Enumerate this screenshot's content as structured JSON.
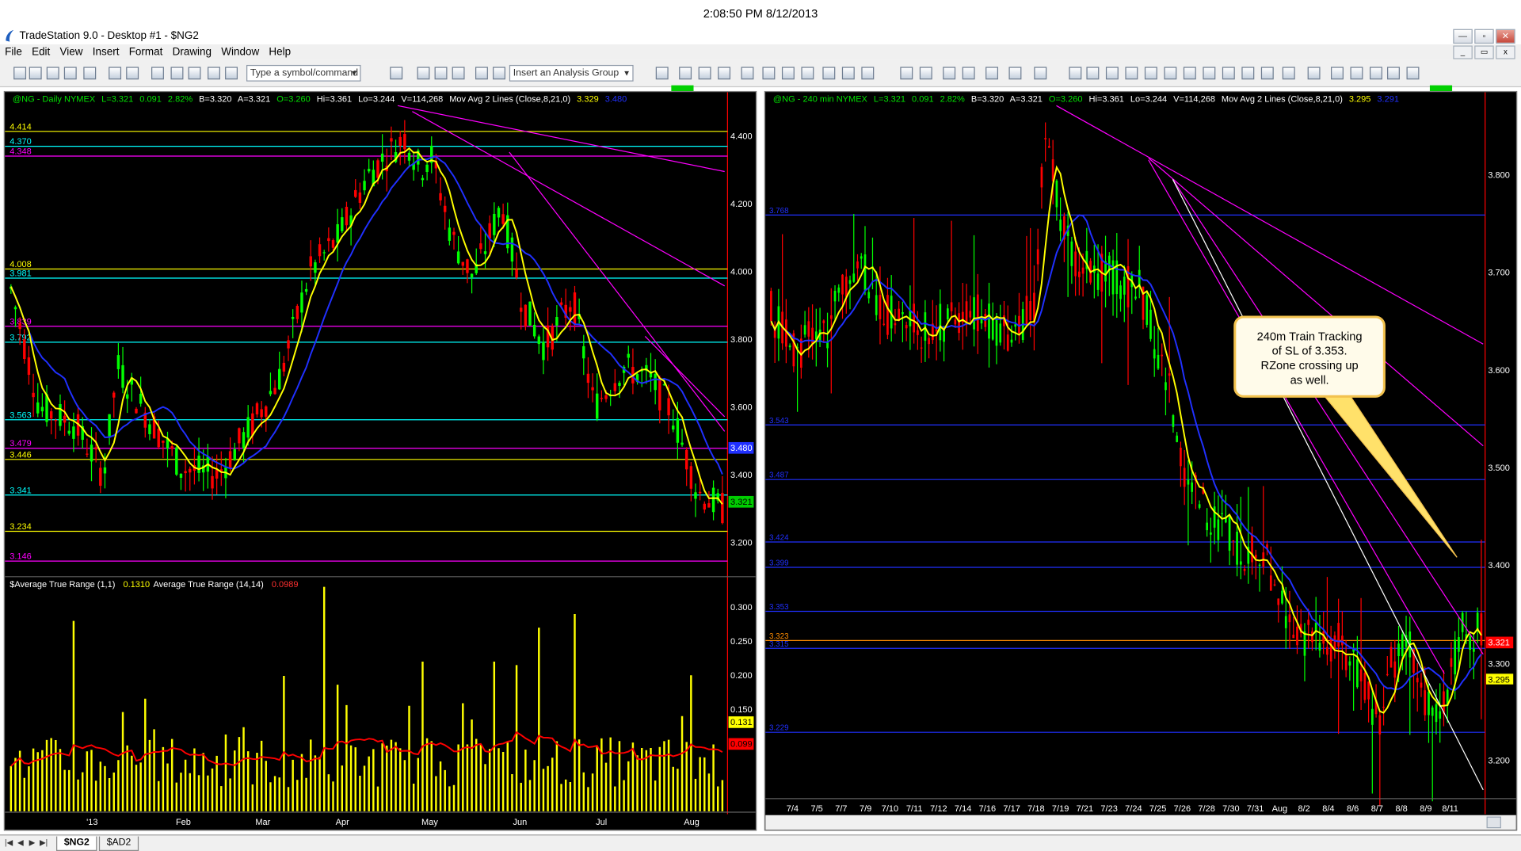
{
  "clock": "2:08:50 PM 8/12/2013",
  "window_title": "TradeStation 9.0 - Desktop #1 - $NG2",
  "menu": [
    "File",
    "Edit",
    "View",
    "Insert",
    "Format",
    "Drawing",
    "Window",
    "Help"
  ],
  "toolbar": {
    "symbol_placeholder": "Type a symbol/command",
    "analysis_group": "Insert an Analysis Group",
    "icons": [
      "new-icon",
      "open-icon",
      "save-icon",
      "print-preview-icon",
      "print-icon",
      "chart-icon",
      "quote-icon",
      "lock-icon",
      "zoom-in-icon",
      "zoom-out-icon",
      "cursor-icon",
      "trendline-icon",
      "fibonacci-icon",
      "arrow-up-icon",
      "arrow-down-icon",
      "circle-icon",
      "text-icon"
    ]
  },
  "colors": {
    "price": "#00ff00",
    "down": "#ff0000",
    "ma_fast": "#ffff00",
    "ma_slow": "#2030ff",
    "magenta": "#ff00ff",
    "cyan": "#00ffff"
  },
  "left_chart": {
    "header": {
      "symbol": "@NG - Daily  NYMEX",
      "last": "L=3.321",
      "chg": "0.091",
      "pct": "2.82%",
      "bid": "B=3.320",
      "ask": "A=3.321",
      "open": "O=3.260",
      "high": "Hi=3.361",
      "low": "Lo=3.244",
      "vol": "V=114,268",
      "study": "Mov Avg 2 Lines (Close,8,21,0)",
      "ma1": "3.329",
      "ma2": "3.480"
    },
    "y_ticks": [
      "4.400",
      "4.200",
      "4.000",
      "3.800",
      "3.600",
      "3.400",
      "3.200"
    ],
    "price_badge": "3.321",
    "ma_badge": "3.480",
    "levels": [
      {
        "label": "4.414",
        "color": "#ffff00",
        "value": 4.414
      },
      {
        "label": "4.370",
        "color": "#00ffff",
        "value": 4.37
      },
      {
        "label": "4.348",
        "color": "#ff00ff",
        "value": 4.341
      },
      {
        "label": "4.008",
        "color": "#ffff00",
        "value": 4.008
      },
      {
        "label": "3.981",
        "color": "#00ffff",
        "value": 3.981
      },
      {
        "label": "3.839",
        "color": "#ff00ff",
        "value": 3.839
      },
      {
        "label": "3.792",
        "color": "#00ffff",
        "value": 3.792
      },
      {
        "label": "3.563",
        "color": "#00ffff",
        "value": 3.563
      },
      {
        "label": "3.479",
        "color": "#ff00ff",
        "value": 3.479
      },
      {
        "label": "3.446",
        "color": "#ffff00",
        "value": 3.446
      },
      {
        "label": "3.341",
        "color": "#00ffff",
        "value": 3.341
      },
      {
        "label": "3.234",
        "color": "#ffff00",
        "value": 3.234
      },
      {
        "label": "3.146",
        "color": "#ff00ff",
        "value": 3.146
      }
    ],
    "indicator": {
      "title": "$Average True Range (1,1)",
      "value1": "0.1310",
      "title2": "Average True Range (14,14)",
      "value2": "0.0989",
      "y_ticks": [
        "0.300",
        "0.250",
        "0.200",
        "0.150"
      ],
      "badge_yellow": "0.131",
      "badge_red": "0.099"
    },
    "x_labels": [
      "'13",
      "Feb",
      "Mar",
      "Apr",
      "May",
      "Jun",
      "Jul",
      "Aug"
    ]
  },
  "right_chart": {
    "header": {
      "symbol": "@NG - 240 min  NYMEX",
      "last": "L=3.321",
      "chg": "0.091",
      "pct": "2.82%",
      "bid": "B=3.320",
      "ask": "A=3.321",
      "open": "O=3.260",
      "high": "Hi=3.361",
      "low": "Lo=3.244",
      "vol": "V=114,268",
      "study": "Mov Avg 2 Lines (Close,8,21,0)",
      "ma1": "3.295",
      "ma2": "3.291"
    },
    "y_ticks": [
      "3.800",
      "3.700",
      "3.600",
      "3.500",
      "3.400",
      "3.300",
      "3.200"
    ],
    "levels": [
      {
        "label": "3.768",
        "value": 3.759
      },
      {
        "label": "3.543",
        "value": 3.544
      },
      {
        "label": "3.487",
        "value": 3.488
      },
      {
        "label": "3.424",
        "value": 3.424
      },
      {
        "label": "3.399",
        "value": 3.398
      },
      {
        "label": "3.353",
        "value": 3.353
      },
      {
        "label": "3.323",
        "value": 3.323
      },
      {
        "label": "3.315",
        "value": 3.315
      },
      {
        "label": "3.229",
        "value": 3.229
      }
    ],
    "badges": {
      "price": "3.321",
      "ma1": "3.300",
      "ma2": "3.295"
    },
    "callout": "240m Train Tracking of SL of 3.353. RZone crossing up as well.",
    "x_labels": [
      "7/4",
      "7/5",
      "7/7",
      "7/9",
      "7/10",
      "7/11",
      "7/12",
      "7/14",
      "7/16",
      "7/17",
      "7/18",
      "7/19",
      "7/21",
      "7/23",
      "7/24",
      "7/25",
      "7/26",
      "7/28",
      "7/30",
      "7/31",
      "Aug",
      "8/2",
      "8/4",
      "8/6",
      "8/7",
      "8/8",
      "8/9",
      "8/11"
    ]
  },
  "tabs": [
    "$NG2",
    "$AD2"
  ]
}
